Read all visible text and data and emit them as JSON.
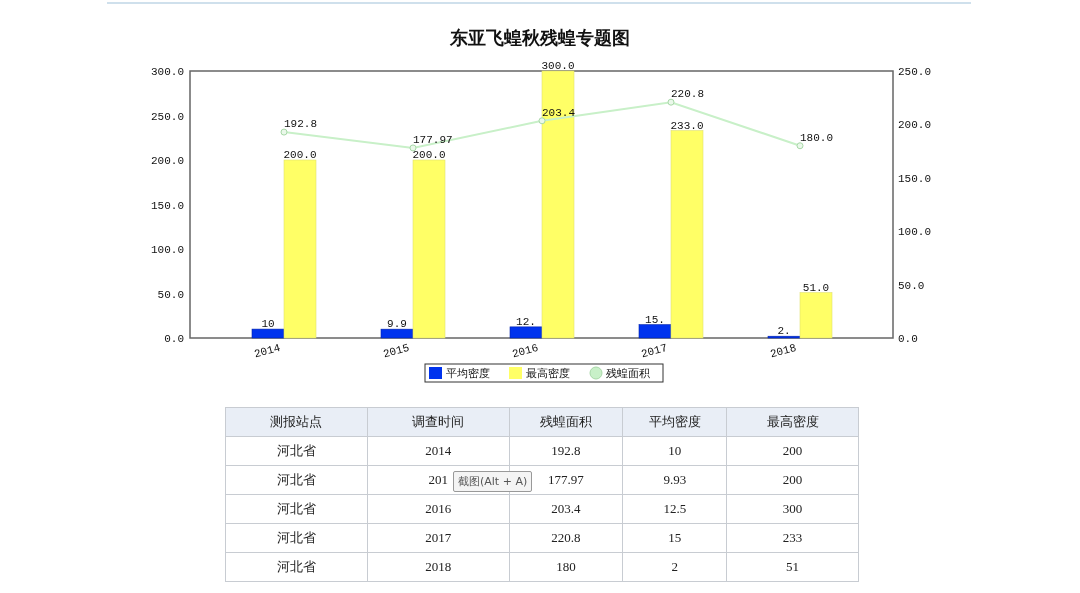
{
  "chart": {
    "chart_data": {
      "type": "bar",
      "title": "东亚飞蝗秋残蝗专题图",
      "categories": [
        "2014",
        "2015",
        "2016",
        "2017",
        "2018"
      ],
      "series": [
        {
          "name": "平均密度",
          "color": "#0033ee",
          "values": [
            10,
            9.93,
            12.5,
            15,
            2
          ],
          "value_labels": [
            "10",
            "9.9",
            "12.",
            "15.",
            "2."
          ]
        },
        {
          "name": "最高密度",
          "color": "#ffff66",
          "values": [
            200,
            200,
            300,
            233,
            51
          ],
          "value_labels": [
            "200.0",
            "200.0",
            "300.0",
            "233.0",
            "51.0"
          ]
        },
        {
          "name": "残蝗面积",
          "type": "line",
          "axis": "y2",
          "marker": "circle",
          "color": "#c8f0c8",
          "values": [
            192.8,
            177.97,
            203.4,
            220.8,
            180
          ],
          "value_labels": [
            "192.8",
            "177.97",
            "203.4",
            "220.8",
            "180.0"
          ]
        }
      ],
      "stacked": false,
      "legend": true,
      "ylim": [
        0,
        300
      ],
      "y2lim": [
        0,
        250
      ],
      "yticks": [
        {
          "value": 0,
          "label": "0.0"
        },
        {
          "value": 50,
          "label": "50.0"
        },
        {
          "value": 100,
          "label": "100.0"
        },
        {
          "value": 150,
          "label": "150.0"
        },
        {
          "value": 200,
          "label": "200.0"
        },
        {
          "value": 250,
          "label": "250.0"
        },
        {
          "value": 300,
          "label": "300.0"
        }
      ],
      "y2ticks": [
        {
          "value": 0,
          "label": "0.0"
        },
        {
          "value": 50,
          "label": "50.0"
        },
        {
          "value": 100,
          "label": "100.0"
        },
        {
          "value": 150,
          "label": "150.0"
        },
        {
          "value": 200,
          "label": "200.0"
        },
        {
          "value": 250,
          "label": "250.0"
        }
      ]
    }
  },
  "table": {
    "columns": [
      "测报站点",
      "调查时间",
      "残蝗面积",
      "平均密度",
      "最高密度"
    ],
    "rows": [
      [
        "河北省",
        "2014",
        "192.8",
        "10",
        "200"
      ],
      [
        "河北省",
        "201",
        "177.97",
        "9.93",
        "200"
      ],
      [
        "河北省",
        "2016",
        "203.4",
        "12.5",
        "300"
      ],
      [
        "河北省",
        "2017",
        "220.8",
        "15",
        "233"
      ],
      [
        "河北省",
        "2018",
        "180",
        "2",
        "51"
      ]
    ]
  },
  "tooltip": {
    "text": "截图(Alt + A)"
  }
}
